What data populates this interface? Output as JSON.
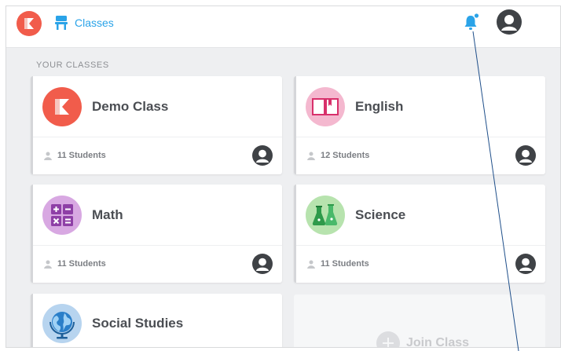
{
  "header": {
    "breadcrumb_label": "Classes",
    "logo_icon": "klassroom-logo-icon",
    "notification_icon": "bell-icon",
    "avatar_icon": "user-avatar-icon",
    "accent_color": "#2aa3e8",
    "brand_color": "#f15c4b"
  },
  "section": {
    "title": "YOUR CLASSES"
  },
  "classes": [
    {
      "name": "Demo Class",
      "students": "11 Students",
      "icon": "klassroom-logo-icon",
      "icon_color": "#f15c4b"
    },
    {
      "name": "English",
      "students": "12 Students",
      "icon": "open-book-icon",
      "icon_color": "#f4b8cf"
    },
    {
      "name": "Math",
      "students": "11 Students",
      "icon": "calculator-symbols-icon",
      "icon_color": "#c98fd6"
    },
    {
      "name": "Science",
      "students": "11 Students",
      "icon": "lab-flasks-icon",
      "icon_color": "#a9dfa1"
    },
    {
      "name": "Social Studies",
      "students": "",
      "icon": "globe-icon",
      "icon_color": "#b7d4ef"
    }
  ],
  "join": {
    "label": "Join Class",
    "icon": "plus-circle-icon"
  }
}
